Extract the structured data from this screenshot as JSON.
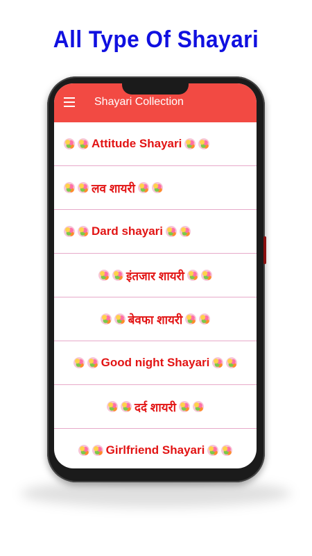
{
  "banner": {
    "title": "All Type Of Shayari"
  },
  "appbar": {
    "title": "Shayari Collection",
    "menu_icon": "menu-icon"
  },
  "colors": {
    "appbar": "#f24a43",
    "item_text": "#e21414",
    "banner_text": "#1010e0",
    "divider": "#e7a9c9"
  },
  "list": {
    "items": [
      {
        "label": "Attitude Shayari",
        "icon": "flower-bouquet-icon"
      },
      {
        "label": "लव शायरी",
        "icon": "flower-bouquet-icon"
      },
      {
        "label": "Dard shayari",
        "icon": "flower-bouquet-icon"
      },
      {
        "label": "इंतजार शायरी",
        "icon": "flower-bouquet-icon"
      },
      {
        "label": "बेवफा शायरी",
        "icon": "flower-bouquet-icon"
      },
      {
        "label": "Good night Shayari",
        "icon": "flower-bouquet-icon"
      },
      {
        "label": "दर्द शायरी",
        "icon": "flower-bouquet-icon"
      },
      {
        "label": "Girlfriend Shayari",
        "icon": "flower-bouquet-icon"
      }
    ]
  }
}
